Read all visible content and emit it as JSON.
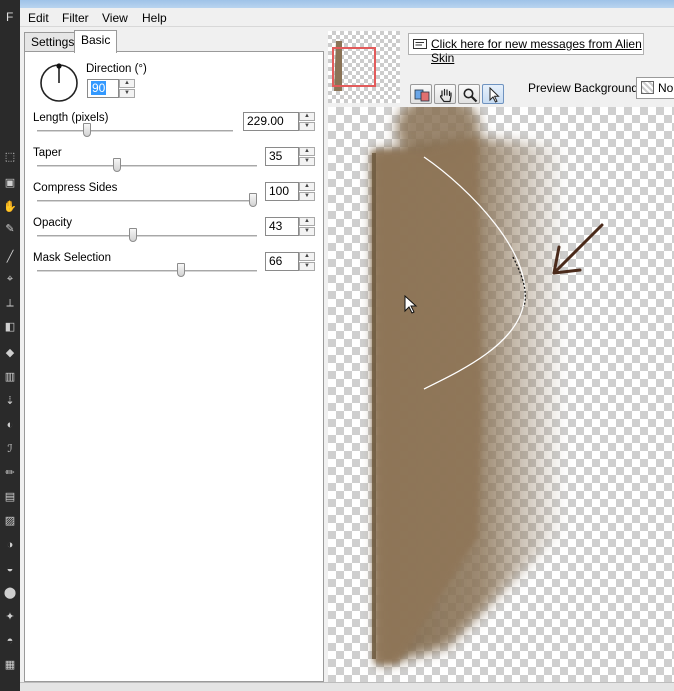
{
  "host": {
    "menu_initial": "F"
  },
  "menubar": {
    "items": [
      "Edit",
      "Filter",
      "View",
      "Help"
    ]
  },
  "tabs": [
    {
      "label": "Settings",
      "active": false
    },
    {
      "label": "Basic",
      "active": true
    }
  ],
  "controls": {
    "direction": {
      "label": "Direction (°)",
      "value": "90"
    },
    "length": {
      "label": "Length (pixels)",
      "value": "229.00",
      "level": 0.2
    },
    "taper": {
      "label": "Taper",
      "value": "35",
      "level": 0.35
    },
    "compress_sides": {
      "label": "Compress Sides",
      "value": "100",
      "level": 1.0
    },
    "opacity": {
      "label": "Opacity",
      "value": "43",
      "level": 0.43
    },
    "mask_selection": {
      "label": "Mask Selection",
      "value": "66",
      "level": 0.66
    }
  },
  "message_bar": {
    "text": "Click here for new messages from Alien Skin"
  },
  "toolbar": {
    "tools": [
      "compare-icon",
      "hand-icon",
      "zoom-icon",
      "arrow-pointer-icon"
    ],
    "active_tool": "arrow-pointer-icon"
  },
  "preview_background": {
    "label": "Preview Background:",
    "value": "Nor"
  },
  "colors": {
    "shadow_brown": "#8a7356",
    "annotation_arrow": "#4a2a1a",
    "nav_frame": "#e25b5b"
  }
}
